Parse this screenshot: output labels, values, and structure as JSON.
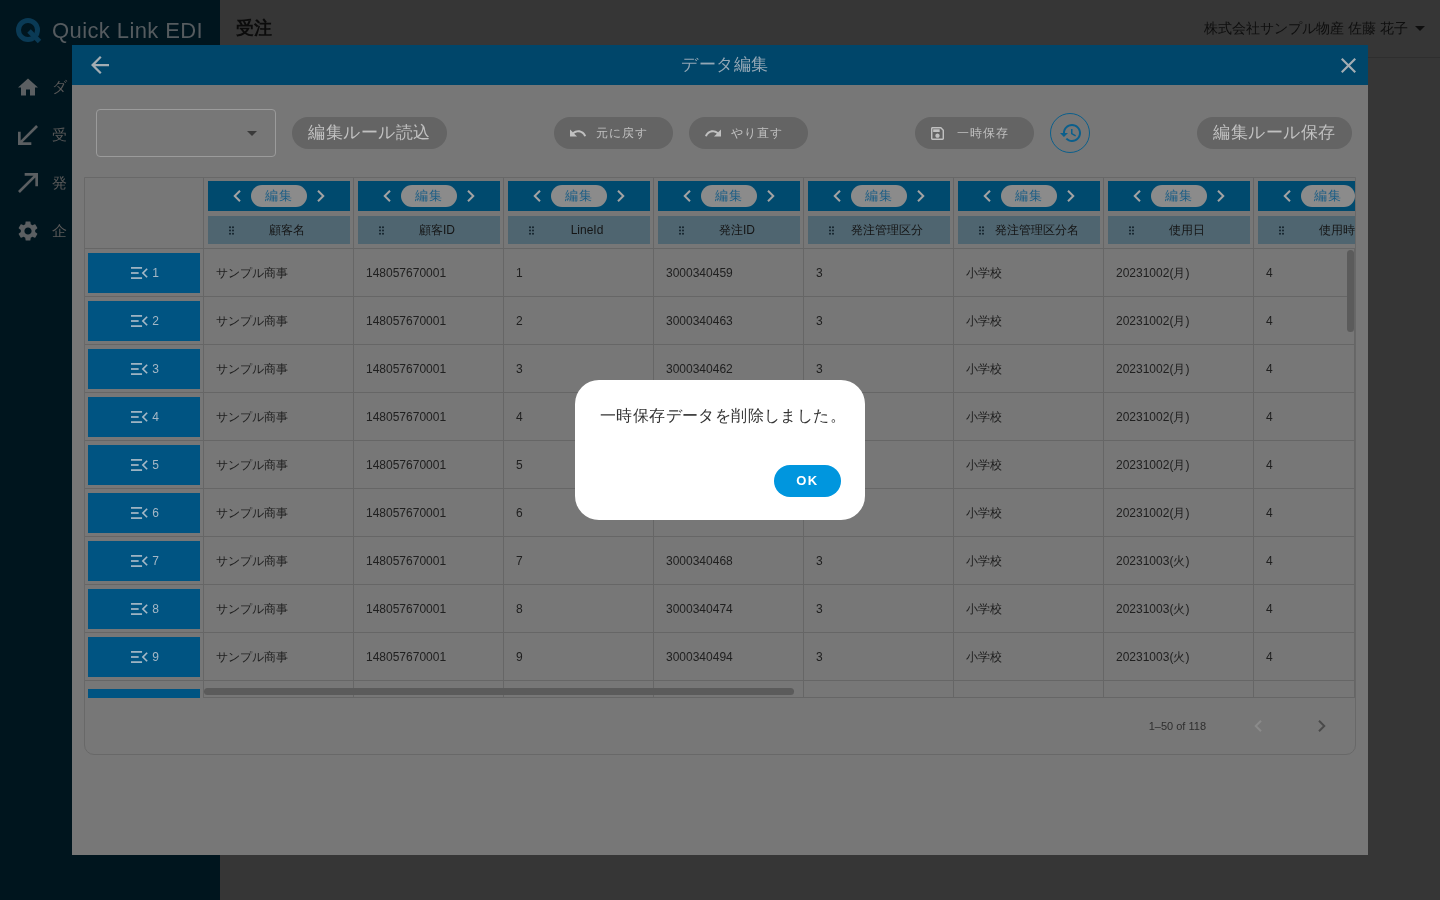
{
  "app": {
    "logo": "Quick Link EDI",
    "page_title": "受注",
    "user_menu": "株式会社サンプル物産 佐藤 花子"
  },
  "sidebar": {
    "items": [
      {
        "label": "ダ"
      },
      {
        "label": "受"
      },
      {
        "label": "発"
      },
      {
        "label": "企"
      }
    ]
  },
  "editor": {
    "title": "データ編集",
    "toolbar_groups": [
      [
        {
          "kind": "select"
        },
        {
          "kind": "pill",
          "label": "編集ルール読込",
          "disabled": true
        }
      ],
      [
        {
          "kind": "icon_pill",
          "label": "元に戻す",
          "disabled": true
        },
        {
          "kind": "icon_pill",
          "label": "やり直す",
          "disabled": true
        }
      ],
      [
        {
          "kind": "icon_pill",
          "label": "一時保存",
          "disabled": true
        },
        {
          "kind": "round",
          "disabled": false
        }
      ],
      [
        {
          "kind": "pill",
          "label": "編集ルール保存",
          "disabled": true
        }
      ]
    ],
    "table": {
      "columns": [
        {
          "label": "顧客名",
          "action": "編集"
        },
        {
          "label": "顧客ID",
          "action": "編集"
        },
        {
          "label": "LineId",
          "action": "編集"
        },
        {
          "label": "発注ID",
          "action": "編集"
        },
        {
          "label": "発注管理区分",
          "action": "編集"
        },
        {
          "label": "発注管理区分名",
          "action": "編集"
        },
        {
          "label": "使用日",
          "action": "編集"
        },
        {
          "label": "使用時",
          "action": "編集"
        }
      ],
      "rows": [
        {
          "number": "1",
          "cells": [
            "サンプル商事",
            "148057670001",
            "1",
            "3000340459",
            "3",
            "小学校",
            "20231002(月)",
            "4"
          ]
        },
        {
          "number": "2",
          "cells": [
            "サンプル商事",
            "148057670001",
            "2",
            "3000340463",
            "3",
            "小学校",
            "20231002(月)",
            "4"
          ]
        },
        {
          "number": "3",
          "cells": [
            "サンプル商事",
            "148057670001",
            "3",
            "3000340462",
            "3",
            "小学校",
            "20231002(月)",
            "4"
          ]
        },
        {
          "number": "4",
          "cells": [
            "サンプル商事",
            "148057670001",
            "4",
            null,
            null,
            "小学校",
            "20231002(月)",
            "4"
          ]
        },
        {
          "number": "5",
          "cells": [
            "サンプル商事",
            "148057670001",
            "5",
            null,
            null,
            "小学校",
            "20231002(月)",
            "4"
          ]
        },
        {
          "number": "6",
          "cells": [
            "サンプル商事",
            "148057670001",
            "6",
            null,
            null,
            "小学校",
            "20231002(月)",
            "4"
          ]
        },
        {
          "number": "7",
          "cells": [
            "サンプル商事",
            "148057670001",
            "7",
            "3000340468",
            "3",
            "小学校",
            "20231003(火)",
            "4"
          ]
        },
        {
          "number": "8",
          "cells": [
            "サンプル商事",
            "148057670001",
            "8",
            "3000340474",
            "3",
            "小学校",
            "20231003(火)",
            "4"
          ]
        },
        {
          "number": "9",
          "cells": [
            "サンプル商事",
            "148057670001",
            "9",
            "3000340494",
            "3",
            "小学校",
            "20231003(火)",
            "4"
          ]
        }
      ],
      "pagination": {
        "range": "1–50 of 118",
        "prev_disabled": true,
        "next_disabled": false
      }
    }
  },
  "dialog": {
    "message": "一時保存データを削除しました。",
    "button": "OK"
  }
}
